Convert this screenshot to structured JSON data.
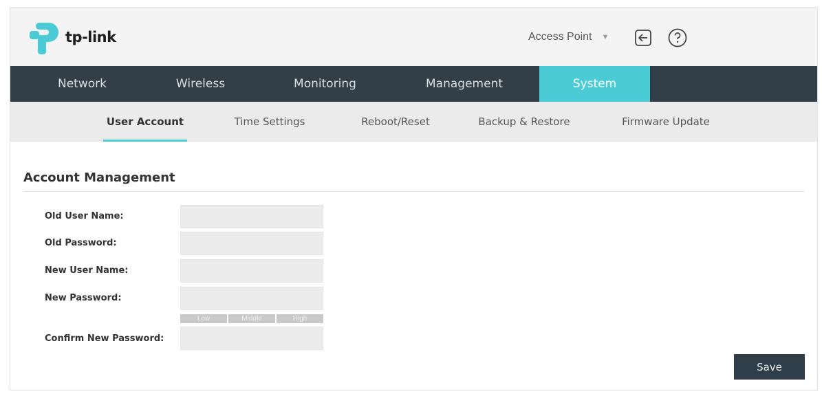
{
  "brand": {
    "name": "tp-link",
    "accent": "#4acbd6",
    "dark": "#333f48"
  },
  "header": {
    "mode_label": "Access Point",
    "mode_icon": "chevron-down-icon",
    "logout_icon": "logout-icon",
    "help_icon": "help-icon"
  },
  "main_nav": {
    "tabs": [
      {
        "label": "Network"
      },
      {
        "label": "Wireless"
      },
      {
        "label": "Monitoring"
      },
      {
        "label": "Management"
      },
      {
        "label": "System",
        "active": true
      }
    ]
  },
  "sub_nav": {
    "tabs": [
      {
        "label": "User Account",
        "active": true
      },
      {
        "label": "Time Settings"
      },
      {
        "label": "Reboot/Reset"
      },
      {
        "label": "Backup & Restore"
      },
      {
        "label": "Firmware Update"
      }
    ]
  },
  "account": {
    "title": "Account Management",
    "fields": [
      {
        "label": "Old User Name:",
        "value": ""
      },
      {
        "label": "Old Password:",
        "value": ""
      },
      {
        "label": "New User Name:",
        "value": ""
      },
      {
        "label": "New Password:",
        "value": ""
      },
      {
        "label": "Confirm New Password:",
        "value": ""
      }
    ],
    "strength": [
      "Low",
      "Middle",
      "High"
    ],
    "save_label": "Save"
  }
}
